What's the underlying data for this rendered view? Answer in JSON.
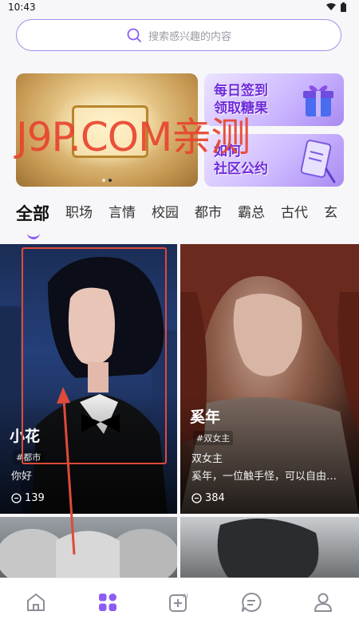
{
  "status": {
    "time": "10:43"
  },
  "search": {
    "placeholder": "搜索感兴趣的内容"
  },
  "banner": {
    "right_top": [
      "每日签到",
      "领取糖果"
    ],
    "right_bottom": [
      "如何",
      "社区公约"
    ]
  },
  "tabs": [
    "全部",
    "职场",
    "言情",
    "校园",
    "都市",
    "霸总",
    "古代",
    "玄"
  ],
  "active_tab": 0,
  "cards": [
    {
      "name": "小花",
      "tag": "#都市",
      "desc": "你好",
      "count": "139"
    },
    {
      "name": "奚年",
      "tag": "#双女主",
      "sub": "双女主",
      "desc": "奚年，一位触手怪，可以自由…",
      "count": "384"
    }
  ],
  "watermark": "J9P.COM亲测",
  "nav": [
    "home-icon",
    "discover-icon",
    "ai-create-icon",
    "chat-icon",
    "profile-icon"
  ],
  "colors": {
    "accent": "#8b5cf6",
    "annotation": "#e04a3a"
  }
}
